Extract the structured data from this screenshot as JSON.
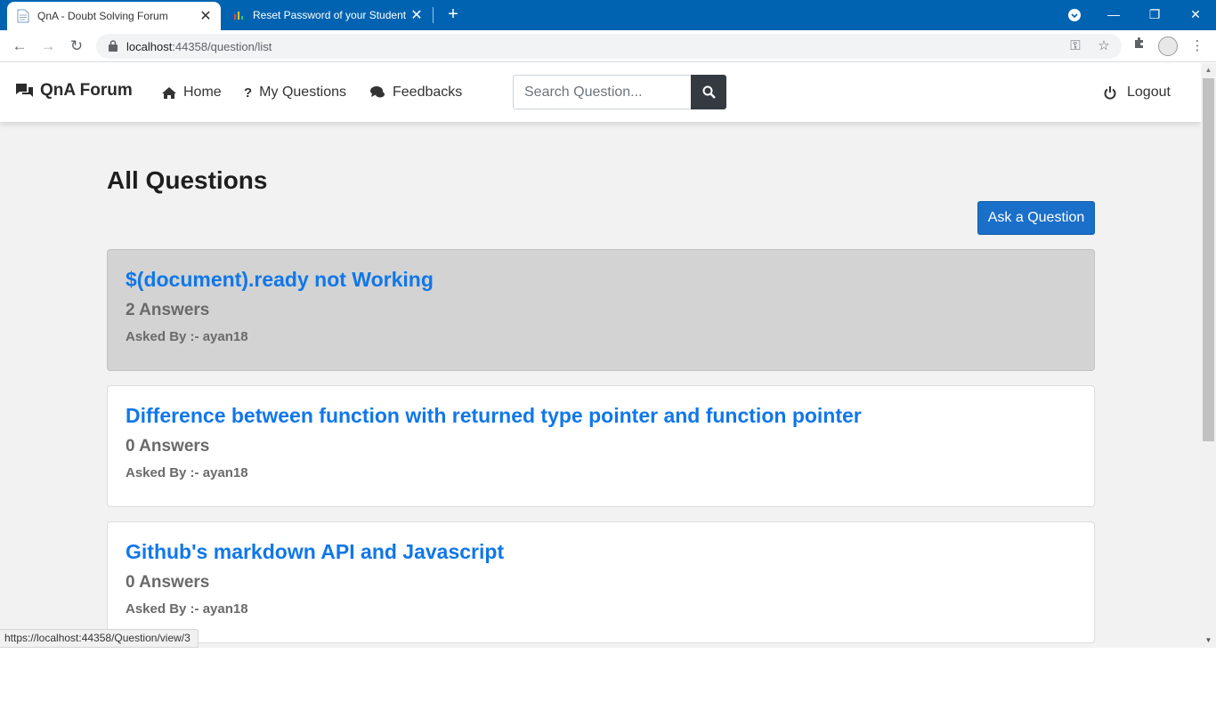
{
  "browser": {
    "tabs": [
      {
        "title": "QnA - Doubt Solving Forum",
        "active": true
      },
      {
        "title": "Reset Password of your Student Port",
        "active": false
      }
    ],
    "url_host": "localhost",
    "url_path": ":44358/question/list",
    "status_url": "https://localhost:44358/Question/view/3"
  },
  "navbar": {
    "brand": "QnA Forum",
    "links": [
      {
        "label": "Home",
        "icon": "home-icon"
      },
      {
        "label": "My Questions",
        "icon": "question-icon"
      },
      {
        "label": "Feedbacks",
        "icon": "comments-icon"
      }
    ],
    "search_placeholder": "Search Question...",
    "logout": "Logout"
  },
  "page": {
    "title": "All Questions",
    "ask_button": "Ask a Question"
  },
  "questions": [
    {
      "title": "$(document).ready not Working",
      "answers": "2 Answers",
      "asked_by": "Asked By :- ayan18",
      "hovered": true
    },
    {
      "title": "Difference between function with returned type pointer and function pointer",
      "answers": "0 Answers",
      "asked_by": "Asked By :- ayan18",
      "hovered": false
    },
    {
      "title": "Github's markdown API and Javascript",
      "answers": "0 Answers",
      "asked_by": "Asked By :- ayan18",
      "hovered": false
    }
  ],
  "colors": {
    "tabbar": "#0063b1",
    "link": "#1077e9",
    "primary_button": "#1a6fc9",
    "search_button": "#343a40"
  }
}
